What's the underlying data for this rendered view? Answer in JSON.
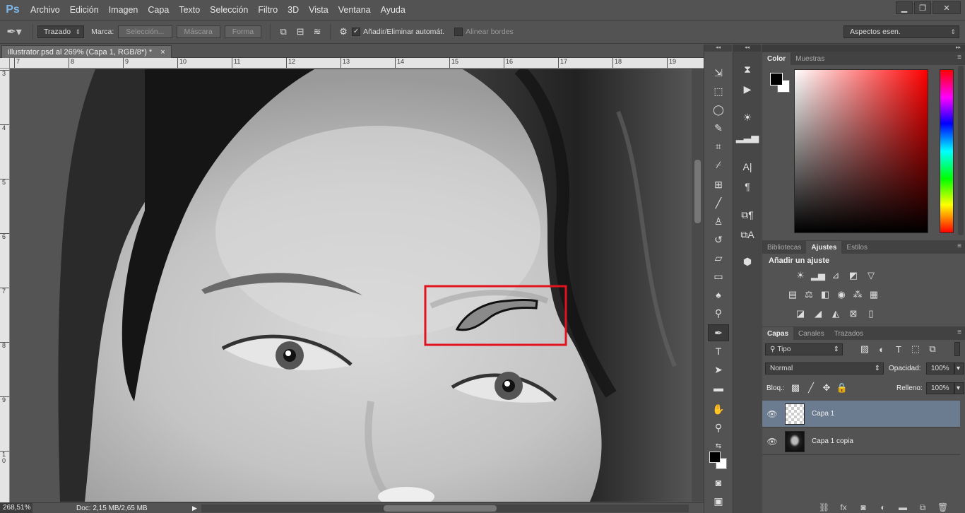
{
  "app": {
    "logo": "Ps"
  },
  "menu": [
    "Archivo",
    "Edición",
    "Imagen",
    "Capa",
    "Texto",
    "Selección",
    "Filtro",
    "3D",
    "Vista",
    "Ventana",
    "Ayuda"
  ],
  "window_controls": {
    "minimize": "▁",
    "restore": "❐",
    "close": "✕"
  },
  "options": {
    "mode_value": "Trazado",
    "marca_label": "Marca:",
    "seleccion_btn": "Selección...",
    "mascara_btn": "Máscara",
    "forma_btn": "Forma",
    "auto_add_label": "Añadir/Eliminar automát.",
    "align_edges_label": "Alinear bordes",
    "workspace": "Aspectos esen."
  },
  "document": {
    "tab_title": "illustrator.psd al 269% (Capa 1, RGB/8*) *",
    "close": "×"
  },
  "ruler": {
    "h_labels": [
      "7",
      "8",
      "9",
      "10",
      "11",
      "12",
      "13",
      "14",
      "15",
      "16",
      "17",
      "18",
      "19"
    ],
    "v_labels": [
      "3",
      "4",
      "5",
      "6",
      "7",
      "8",
      "9",
      "1\n0"
    ]
  },
  "status": {
    "zoom": "268,51%",
    "doc": "Doc: 2,15 MB/2,65 MB"
  },
  "color_panel": {
    "tabs": [
      "Color",
      "Muestras"
    ],
    "foreground": "#000000",
    "background": "#ffffff"
  },
  "adjust_panel": {
    "tabs": [
      "Bibliotecas",
      "Ajustes",
      "Estilos"
    ],
    "title": "Añadir un ajuste"
  },
  "layers_panel": {
    "tabs": [
      "Capas",
      "Canales",
      "Trazados"
    ],
    "filter": "Tipo",
    "blend_mode": "Normal",
    "opacity_label": "Opacidad:",
    "opacity_value": "100%",
    "lock_label": "Bloq.:",
    "fill_label": "Relleno:",
    "fill_value": "100%",
    "layers": [
      {
        "name": "Capa 1",
        "selected": true
      },
      {
        "name": "Capa 1 copia",
        "selected": false
      }
    ]
  },
  "colors": {
    "highlight_box": "#e0141e",
    "selected_layer": "#6c7c90"
  }
}
